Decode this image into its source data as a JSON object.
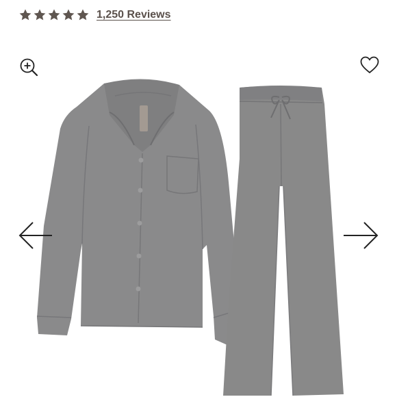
{
  "rating": {
    "stars": 5,
    "max_stars": 5,
    "reviews_label": "1,250 Reviews"
  },
  "icons": {
    "star": "star-icon",
    "zoom": "zoom-in-icon",
    "wishlist": "heart-icon",
    "prev": "arrow-left-icon",
    "next": "arrow-right-icon"
  },
  "colors": {
    "star": "#5f5650",
    "link": "#5a504b",
    "garment": "#8a8a8b",
    "garment_shadow": "#747476",
    "icon": "#222222"
  }
}
